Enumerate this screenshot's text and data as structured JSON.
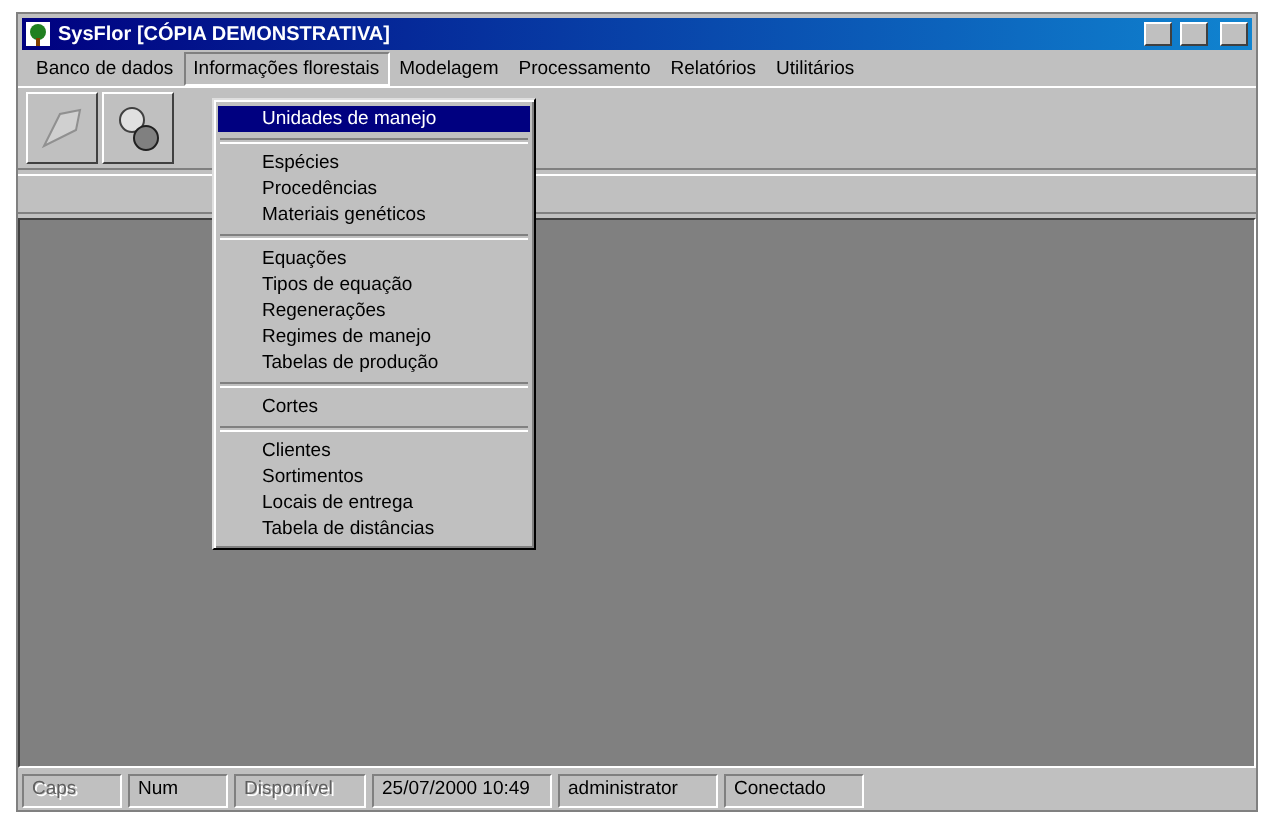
{
  "window": {
    "title": "SysFlor [CÓPIA DEMONSTRATIVA]"
  },
  "menu_bar": [
    {
      "label": "Banco de dados",
      "selected": false
    },
    {
      "label": "Informações florestais",
      "selected": true
    },
    {
      "label": "Modelagem",
      "selected": false
    },
    {
      "label": "Processamento",
      "selected": false
    },
    {
      "label": "Relatórios",
      "selected": false
    },
    {
      "label": "Utilitários",
      "selected": false
    }
  ],
  "dropdown": [
    {
      "kind": "item",
      "label": "Unidades de manejo",
      "selected": true
    },
    {
      "kind": "separator"
    },
    {
      "kind": "item",
      "label": "Espécies",
      "selected": false
    },
    {
      "kind": "item",
      "label": "Procedências",
      "selected": false
    },
    {
      "kind": "item",
      "label": "Materiais genéticos",
      "selected": false
    },
    {
      "kind": "separator"
    },
    {
      "kind": "item",
      "label": "Equações",
      "selected": false
    },
    {
      "kind": "item",
      "label": "Tipos de equação",
      "selected": false
    },
    {
      "kind": "item",
      "label": "Regenerações",
      "selected": false
    },
    {
      "kind": "item",
      "label": "Regimes de manejo",
      "selected": false
    },
    {
      "kind": "item",
      "label": "Tabelas de produção",
      "selected": false
    },
    {
      "kind": "separator"
    },
    {
      "kind": "item",
      "label": "Cortes",
      "selected": false
    },
    {
      "kind": "separator"
    },
    {
      "kind": "item",
      "label": "Clientes",
      "selected": false
    },
    {
      "kind": "item",
      "label": "Sortimentos",
      "selected": false
    },
    {
      "kind": "item",
      "label": "Locais de entrega",
      "selected": false
    },
    {
      "kind": "item",
      "label": "Tabela de distâncias",
      "selected": false
    }
  ],
  "status_bar": [
    {
      "text": "Caps",
      "disabled": true
    },
    {
      "text": "Num",
      "disabled": false
    },
    {
      "text": "Disponível",
      "disabled": true
    },
    {
      "text": "25/07/2000 10:49",
      "disabled": false
    },
    {
      "text": "administrator",
      "disabled": false
    },
    {
      "text": "Conectado",
      "disabled": false
    }
  ]
}
